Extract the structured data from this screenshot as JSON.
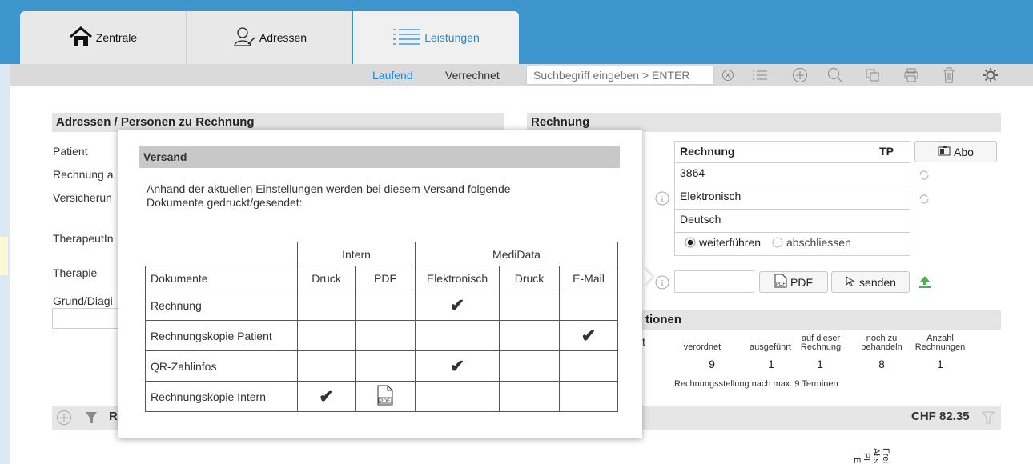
{
  "tabs": [
    {
      "label": "Zentrale",
      "icon": "home-icon"
    },
    {
      "label": "Adressen",
      "icon": "person-icon"
    },
    {
      "label": "Leistungen",
      "icon": "list-icon"
    }
  ],
  "subtabs": {
    "laufend": "Laufend",
    "verrechnet": "Verrechnet"
  },
  "search": {
    "placeholder": "Suchbegriff eingeben > ENTER"
  },
  "toolbar_icons": [
    "clear-icon",
    "list-icon",
    "add-icon",
    "search-icon",
    "copy-icon",
    "print-icon",
    "trash-icon",
    "gear-icon"
  ],
  "left": {
    "header": "Adressen / Personen zu Rechnung",
    "labels": [
      "Patient",
      "Rechnung a",
      "Versicherun",
      "TherapeutIn",
      "Therapie",
      "Grund/Diagi"
    ]
  },
  "right": {
    "header": "Rechnung",
    "type": "Rechnung",
    "type_code": "TP",
    "abo": "Abo",
    "number": "3864",
    "delivery": "Elektronisch",
    "language": "Deutsch",
    "radio_continue": "weiterführen",
    "radio_close": "abschliessen",
    "pdf_button": "PDF",
    "send_button": "senden"
  },
  "positions": {
    "header_fragment": "tionen",
    "side_fragment": "t",
    "cols": [
      "verordnet",
      "ausgeführt",
      "auf dieser Rechnung",
      "noch zu behandeln",
      "Anzahl Rechnungen"
    ],
    "values": [
      "9",
      "1",
      "1",
      "8",
      "1"
    ],
    "note": "Rechnungsstellung nach max. 9 Terminen"
  },
  "footer": {
    "letter": "R",
    "amount": "CHF 82.35",
    "rotated": [
      "Frei",
      "Abs",
      "Pl",
      "E"
    ]
  },
  "modal": {
    "title": "Versand",
    "text": "Anhand der aktuellen Einstellungen werden bei diesem Versand folgende Dokumente gedruckt/gesendet:",
    "group_intern": "Intern",
    "group_medidata": "MediData",
    "col_docs": "Dokumente",
    "cols": [
      "Druck",
      "PDF",
      "Elektronisch",
      "Druck",
      "E-Mail"
    ],
    "rows": [
      {
        "name": "Rechnung",
        "marks": [
          "",
          "",
          "check",
          "",
          ""
        ]
      },
      {
        "name": "Rechnungskopie Patient",
        "marks": [
          "",
          "",
          "",
          "",
          "check"
        ]
      },
      {
        "name": "QR-Zahlinfos",
        "marks": [
          "",
          "",
          "check",
          "",
          ""
        ]
      },
      {
        "name": "Rechnungskopie Intern",
        "marks": [
          "check",
          "pdf",
          "",
          "",
          ""
        ]
      }
    ]
  },
  "colors": {
    "topbar": "#3e95cd",
    "active_tab": "#1e88d8",
    "upload_icon": "#4caf50"
  }
}
